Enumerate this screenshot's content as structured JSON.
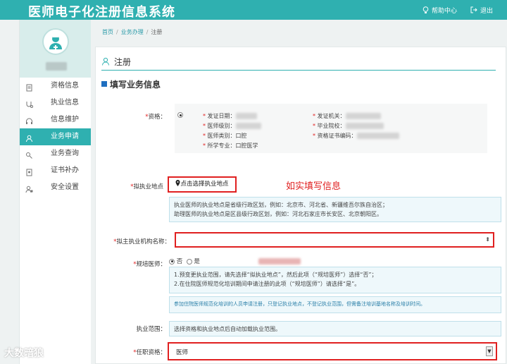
{
  "header": {
    "title": "医师电子化注册信息系统",
    "help": "帮助中心",
    "logout": "退出",
    "help_icon": "lightbulb-icon",
    "logout_icon": "logout-icon"
  },
  "sidebar": {
    "avatar_icon": "doctor-avatar-icon",
    "items": [
      {
        "label": "资格信息",
        "icon": "document-icon",
        "active": false
      },
      {
        "label": "执业信息",
        "icon": "stethoscope-icon",
        "active": false
      },
      {
        "label": "信息维护",
        "icon": "headset-icon",
        "active": false
      },
      {
        "label": "业务申请",
        "icon": "user-icon",
        "active": true
      },
      {
        "label": "业务查询",
        "icon": "search-user-icon",
        "active": false
      },
      {
        "label": "证书补办",
        "icon": "certificate-icon",
        "active": false
      },
      {
        "label": "安全设置",
        "icon": "user-lock-icon",
        "active": false
      }
    ]
  },
  "breadcrumb": {
    "home": "首页",
    "business": "业务办理",
    "current": "注册"
  },
  "main": {
    "heading": "注册",
    "heading_icon": "user-outline-icon",
    "section_title": "填写业务信息",
    "qualification": {
      "label": "资格：",
      "fields": {
        "issue_date": "发证日期：",
        "issuer": "发证机关：",
        "level": "医师级别：",
        "school": "毕业院校：",
        "category": "医师类别：口腔",
        "cert_no": "资格证书编码：",
        "specialty": "所学专业：口腔医学"
      }
    },
    "practice_location": {
      "label": "拟执业地点",
      "button": "点击选择执业地点",
      "button_icon": "map-pin-icon",
      "annotation": "如实填写信息",
      "help_line1": "执业医师的执业地点是省级行政区划，例如：北京市、河北省、新疆维吾尔族自治区；",
      "help_line2": "助理医师的执业地点是区县级行政区划，例如：河北石家庄市长安区、北京朝阳区。"
    },
    "institution": {
      "label": "拟主执业机构名称：",
      "value": ""
    },
    "standardized": {
      "label": "规培医师：",
      "option_no": "否",
      "option_yes": "是",
      "selected": "否",
      "note1": "1.预变更执业范围，请先选择“拟执业地点”，然后此项（“规培医师”）选择“否”；",
      "note2": "2.在住院医师规范化培训期间申请注册的此项（“规培医师”）请选择“是”。",
      "note3": "参加住院医师规范化培训的人员申请注册，只登记执业地点，不登记执业范围，但需备注培训基地名称及培训时间。"
    },
    "scope": {
      "label": "执业范围：",
      "hint": "选择资格和执业地点后自动加载执业范围。"
    },
    "job_qualification": {
      "label": "任职资格：",
      "value": "医师"
    }
  },
  "watermark": "大数暗狼",
  "colors": {
    "accent": "#2fb0b0",
    "annotation": "#e02020",
    "link": "#2a9aa8"
  }
}
